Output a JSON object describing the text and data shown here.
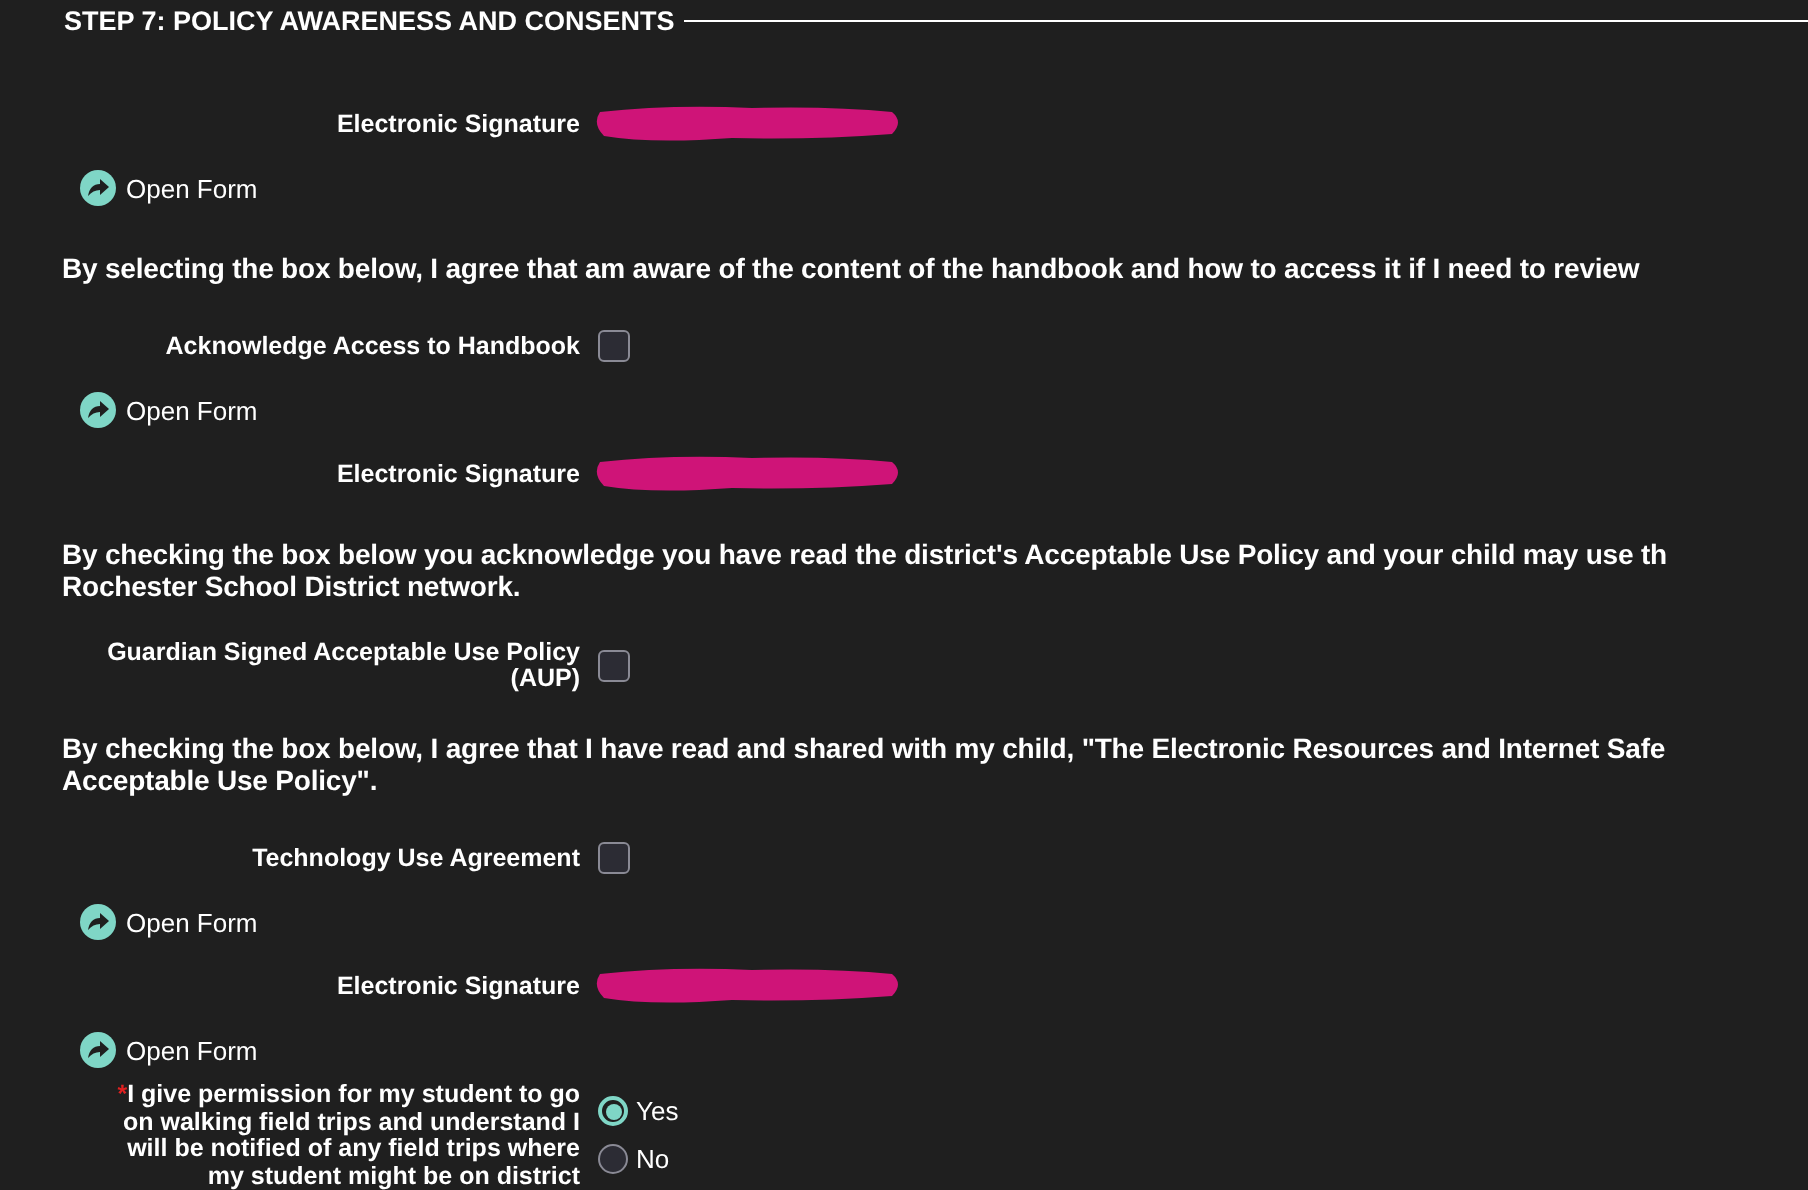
{
  "section": {
    "title": "STEP 7: POLICY AWARENESS AND CONSENTS"
  },
  "items": [
    {
      "kind": "signature",
      "label": "Electronic Signature"
    },
    {
      "kind": "open_form",
      "label": "Open Form"
    },
    {
      "kind": "paragraph",
      "lines": [
        "By selecting the box below, I agree that am aware of the content of the handbook and how to access it if I need to review"
      ]
    },
    {
      "kind": "checkbox",
      "label_lines": [
        "Acknowledge Access to Handbook"
      ],
      "checked": false
    },
    {
      "kind": "open_form",
      "label": "Open Form"
    },
    {
      "kind": "signature",
      "label": "Electronic Signature"
    },
    {
      "kind": "paragraph",
      "lines": [
        "By checking the box below you acknowledge you have read the district's Acceptable Use Policy and your child may use th",
        "Rochester School District network."
      ]
    },
    {
      "kind": "checkbox",
      "label_lines": [
        "Guardian Signed Acceptable Use Policy",
        "(AUP)"
      ],
      "checked": false
    },
    {
      "kind": "paragraph",
      "lines": [
        "By checking the box below, I agree that I have read and shared with my child, \"The Electronic Resources and Internet Safe",
        "Acceptable Use Policy\"."
      ]
    },
    {
      "kind": "checkbox",
      "label_lines": [
        "Technology Use Agreement"
      ],
      "checked": false
    },
    {
      "kind": "open_form",
      "label": "Open Form"
    },
    {
      "kind": "signature",
      "label": "Electronic Signature"
    },
    {
      "kind": "open_form",
      "label": "Open Form"
    },
    {
      "kind": "radio",
      "required": "*",
      "label_lines": [
        "I give permission for my student to go",
        "on walking field trips and understand I",
        "will be notified of any field trips where",
        "my student might be on district"
      ],
      "options": [
        {
          "label": "Yes",
          "selected": true
        },
        {
          "label": "No",
          "selected": false
        }
      ]
    }
  ]
}
